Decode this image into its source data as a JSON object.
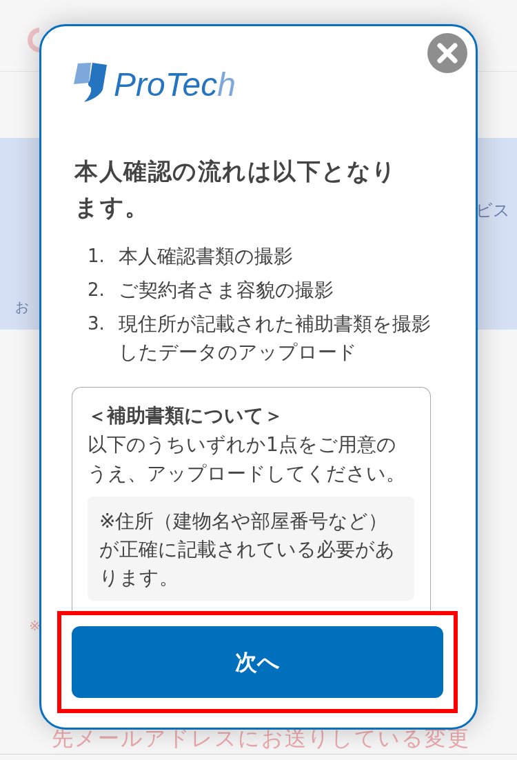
{
  "background": {
    "banner_right_text": "ビス",
    "banner_left_text": "お",
    "note_mark": "※",
    "bottom_text": "先メールアドレスにお送りしている変更"
  },
  "dialog": {
    "logo": {
      "text": "ProTec",
      "accent_text": "h"
    },
    "title": "本人確認の流れは以下となります。",
    "steps": [
      {
        "number": "1.",
        "text": "本人確認書類の撮影"
      },
      {
        "number": "2.",
        "text": "ご契約者さま容貌の撮影"
      },
      {
        "number": "3.",
        "text": "現住所が記載された補助書類を撮影したデータのアップロード"
      }
    ],
    "notice": {
      "heading": "＜補助書類について＞",
      "body": "以下のうちいずれか1点をご用意のうえ、アップロードしてください。",
      "note": "※住所（建物名や部屋番号など）が正確に記載されている必要があります。"
    },
    "next_button": {
      "label": "次へ",
      "highlighted": true
    }
  }
}
